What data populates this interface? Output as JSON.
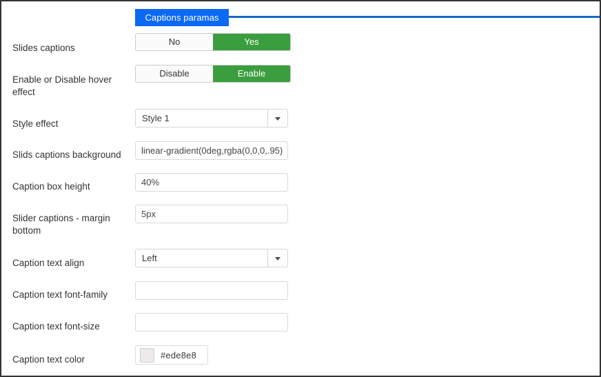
{
  "tab": {
    "label": "Captions paramas",
    "accent_color": "#0b69f5",
    "underline_color": "#1369c4"
  },
  "theme": {
    "toggle_active_color": "#3a9e3e",
    "border_color": "#333333"
  },
  "form": {
    "rows": [
      {
        "id": "slides-captions",
        "label": "Slides captions",
        "type": "toggle",
        "options": [
          "No",
          "Yes"
        ],
        "selected": "Yes"
      },
      {
        "id": "hover-effect",
        "label": "Enable or Disable hover effect",
        "type": "toggle",
        "options": [
          "Disable",
          "Enable"
        ],
        "selected": "Enable"
      },
      {
        "id": "style-effect",
        "label": "Style effect",
        "type": "select",
        "value": "Style 1",
        "options": [
          "Style 1"
        ]
      },
      {
        "id": "captions-background",
        "label": "Slids captions background",
        "type": "text",
        "value": "linear-gradient(0deg,rgba(0,0,0,.95)",
        "placeholder": ""
      },
      {
        "id": "caption-box-height",
        "label": "Caption box height",
        "type": "text",
        "value": "40%",
        "placeholder": ""
      },
      {
        "id": "captions-margin-bottom",
        "label": "Slider captions - margin bottom",
        "type": "text",
        "value": "5px",
        "placeholder": ""
      },
      {
        "id": "caption-text-align",
        "label": "Caption text align",
        "type": "select",
        "value": "Left",
        "options": [
          "Left"
        ]
      },
      {
        "id": "caption-font-family",
        "label": "Caption text font-family",
        "type": "text",
        "value": "",
        "placeholder": ""
      },
      {
        "id": "caption-font-size",
        "label": "Caption text font-size",
        "type": "text",
        "value": "",
        "placeholder": ""
      },
      {
        "id": "caption-text-color",
        "label": "Caption text color",
        "type": "color",
        "value": "#ede8e8",
        "swatch_color": "#efeaea"
      }
    ]
  }
}
